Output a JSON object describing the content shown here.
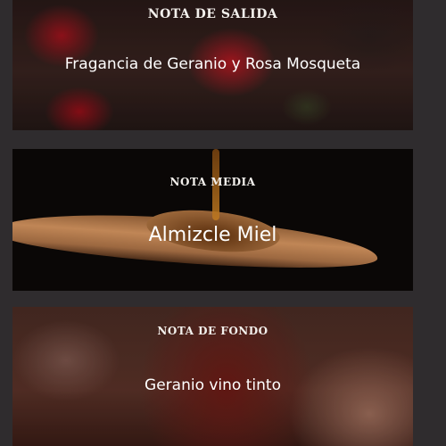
{
  "notes": {
    "top": {
      "heading": "NOTA DE SALIDA",
      "description": "Fragancia de Geranio y Rosa Mosqueta",
      "image": "roses"
    },
    "middle": {
      "heading": "NOTA MEDIA",
      "description": "Almizcle Miel",
      "image": "honey-spoon"
    },
    "base": {
      "heading": "NOTA DE FONDO",
      "description": "Geranio vino tinto",
      "image": "red-wine-glass"
    }
  },
  "colors": {
    "page_background": "#2f2c2e",
    "heading_text": "#f3f0ec",
    "description_text": "#ffffff"
  }
}
